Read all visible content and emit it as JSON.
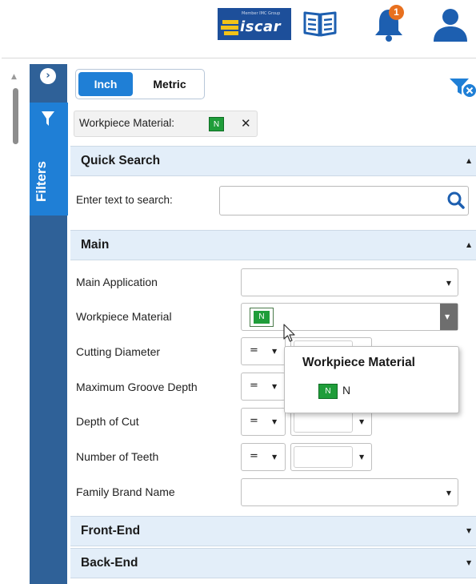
{
  "header": {
    "logo_text": "iscar",
    "logo_subtext": "Member IMC Group",
    "notification_count": "1",
    "icons": [
      "catalog-book-icon",
      "notification-bell-icon",
      "user-icon"
    ]
  },
  "sidebar": {
    "label": "Filters",
    "toggle_icon": "chevron-right-icon",
    "tab_icon": "filter-funnel-icon"
  },
  "units": {
    "inch_label": "Inch",
    "metric_label": "Metric",
    "selected": "Inch"
  },
  "active_filter": {
    "label": "Workpiece Material:",
    "value": "N",
    "remove_icon": "close-icon"
  },
  "quick_search": {
    "title": "Quick Search",
    "prompt": "Enter text to search:",
    "value": "",
    "placeholder": ""
  },
  "main": {
    "title": "Main",
    "fields": [
      {
        "label": "Main Application",
        "value": ""
      },
      {
        "label": "Workpiece Material",
        "value": "N"
      },
      {
        "label": "Cutting Diameter",
        "operator": "="
      },
      {
        "label": "Maximum Groove Depth",
        "operator": "="
      },
      {
        "label": "Depth of Cut",
        "operator": "="
      },
      {
        "label": "Number of Teeth",
        "operator": "="
      },
      {
        "label": "Family Brand Name",
        "value": ""
      }
    ]
  },
  "tooltip": {
    "title": "Workpiece Material",
    "badge": "N",
    "text": "N"
  },
  "collapsed_sections": [
    "Front-End",
    "Back-End"
  ],
  "colors": {
    "sidebar_blue": "#2f6198",
    "accent_blue": "#1f7fd6",
    "material_green": "#1f9d3a",
    "notification_orange": "#e8701e",
    "section_bg": "#e3eef9"
  }
}
